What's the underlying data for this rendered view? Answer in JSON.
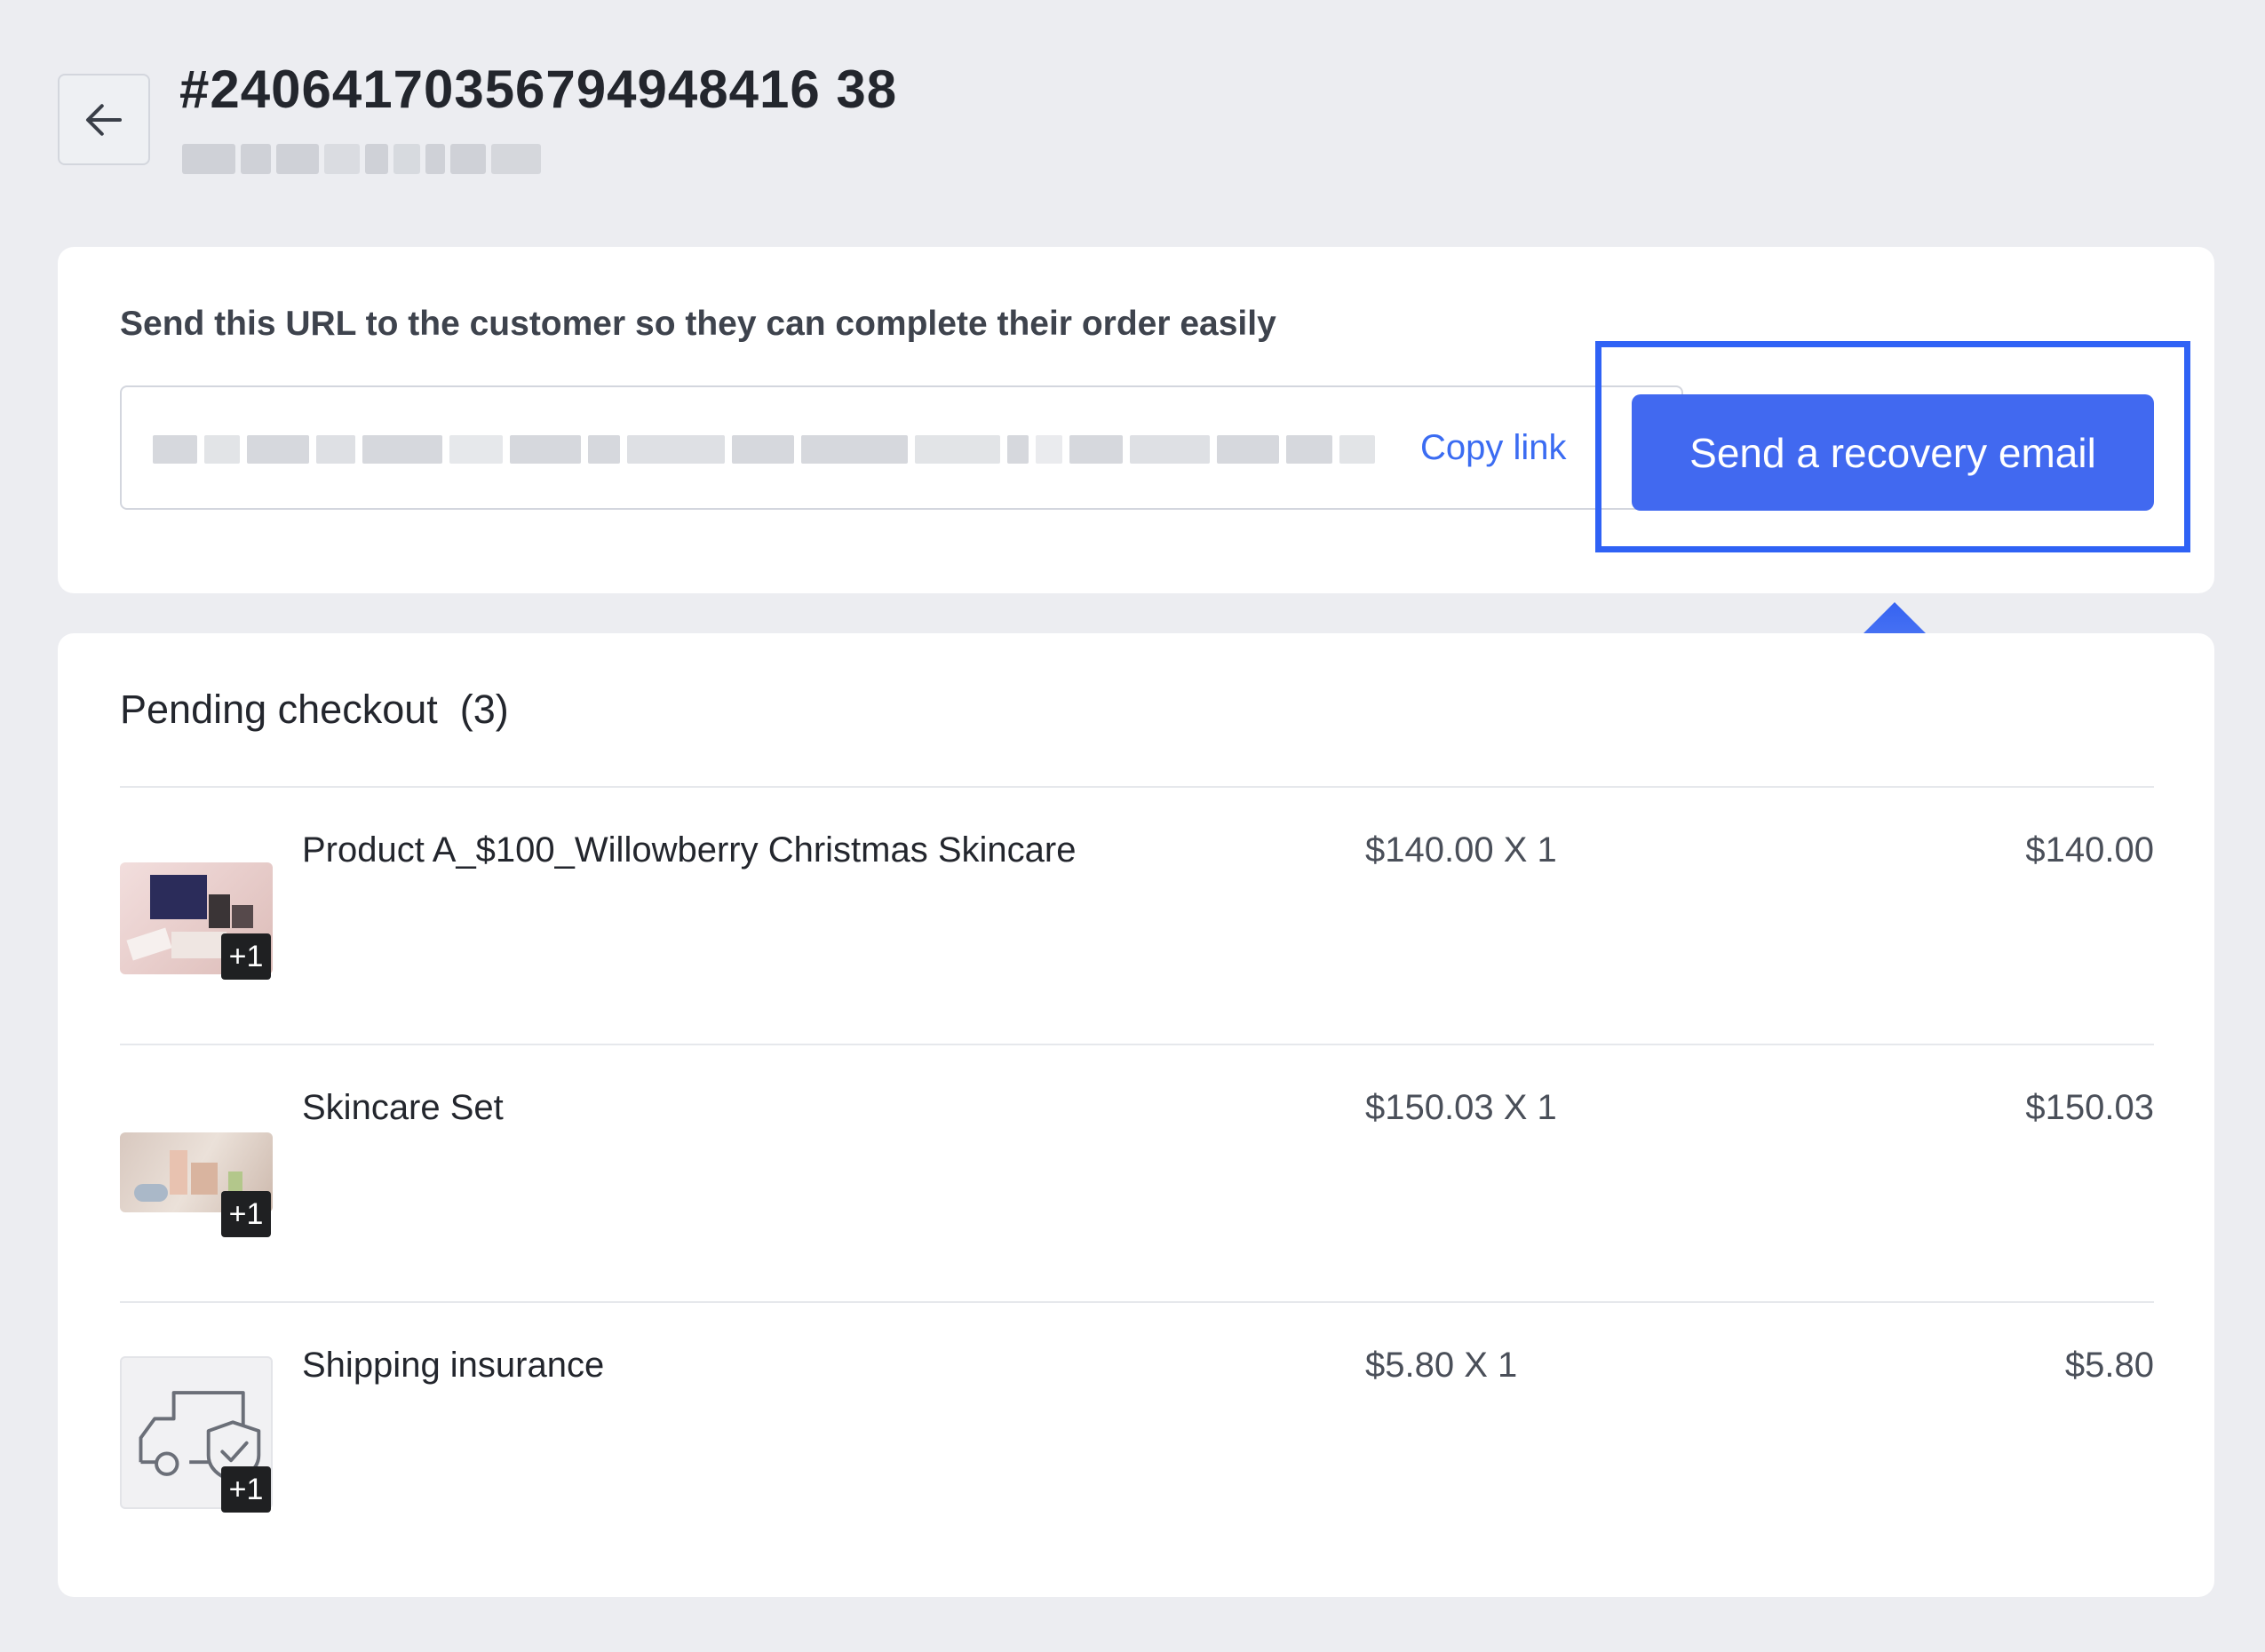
{
  "header": {
    "order_number": "#24064170356794948416 38"
  },
  "url_card": {
    "heading": "Send this URL to the customer so they can complete their order easily",
    "copy_link_label": "Copy link",
    "send_button_label": "Send a recovery email"
  },
  "pending": {
    "title": "Pending checkout  (3)",
    "items": [
      {
        "name": "Product A_$100_Willowberry Christmas Skincare",
        "price_qty": "$140.00 X 1",
        "total": "$140.00",
        "badge": "+1",
        "thumb": "skincare-gift-box-image"
      },
      {
        "name": "Skincare Set",
        "price_qty": "$150.03 X 1",
        "total": "$150.03",
        "badge": "+1",
        "thumb": "skincare-set-image"
      },
      {
        "name": "Shipping insurance",
        "price_qty": "$5.80 X 1",
        "total": "$5.80",
        "badge": "+1",
        "thumb": "shipping-truck-icon"
      }
    ]
  },
  "colors": {
    "accent": "#4169f0",
    "highlight": "#2f62f5",
    "link": "#3b6cf2",
    "background": "#ecedf1"
  }
}
